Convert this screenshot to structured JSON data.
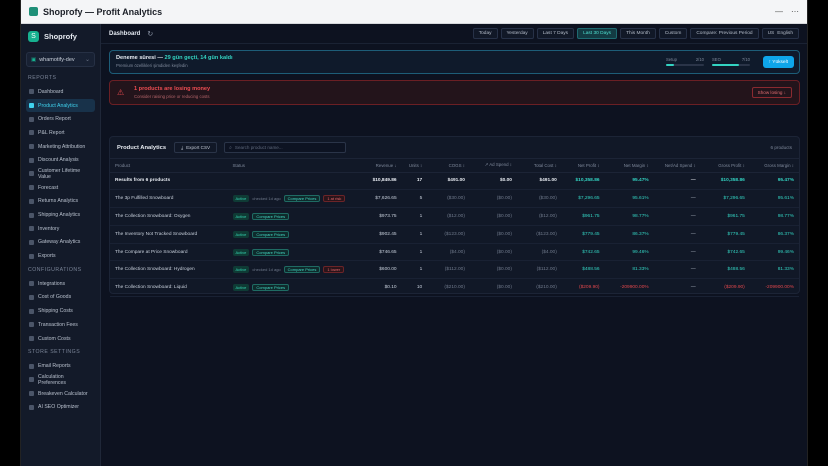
{
  "window": {
    "title": "Shoprofy — Profit Analytics"
  },
  "sidebar": {
    "brand": "Shoprofy",
    "store": "whamotify-dev",
    "sections": [
      {
        "title": "REPORTS",
        "items": [
          {
            "label": "Dashboard",
            "icon": "dashboard-icon",
            "active": false
          },
          {
            "label": "Product Analytics",
            "icon": "chart-icon",
            "active": true
          },
          {
            "label": "Orders Report",
            "icon": "orders-icon",
            "active": false
          },
          {
            "label": "P&L Report",
            "icon": "pl-icon",
            "active": false
          },
          {
            "label": "Marketing Attribution",
            "icon": "marketing-icon",
            "active": false
          },
          {
            "label": "Discount Analysis",
            "icon": "discount-icon",
            "active": false
          },
          {
            "label": "Customer Lifetime Value",
            "icon": "customer-icon",
            "active": false
          },
          {
            "label": "Forecast",
            "icon": "forecast-icon",
            "active": false
          },
          {
            "label": "Returns Analytics",
            "icon": "returns-icon",
            "active": false
          },
          {
            "label": "Shipping Analytics",
            "icon": "shipping-icon",
            "active": false
          },
          {
            "label": "Inventory",
            "icon": "inventory-icon",
            "active": false
          },
          {
            "label": "Gateway Analytics",
            "icon": "gateway-icon",
            "active": false
          },
          {
            "label": "Exports",
            "icon": "export-icon",
            "active": false
          }
        ]
      },
      {
        "title": "CONFIGURATIONS",
        "items": [
          {
            "label": "Integrations",
            "icon": "plug-icon",
            "active": false
          },
          {
            "label": "Cost of Goods",
            "icon": "cost-icon",
            "active": false
          },
          {
            "label": "Shipping Costs",
            "icon": "truck-icon",
            "active": false
          },
          {
            "label": "Transaction Fees",
            "icon": "fee-icon",
            "active": false
          },
          {
            "label": "Custom Costs",
            "icon": "plus-icon",
            "active": false
          }
        ]
      },
      {
        "title": "STORE SETTINGS",
        "items": [
          {
            "label": "Email Reports",
            "icon": "mail-icon",
            "active": false
          },
          {
            "label": "Calculation Preferences",
            "icon": "calc-icon",
            "active": false
          },
          {
            "label": "Breakeven Calculator",
            "icon": "breakeven-icon",
            "active": false
          },
          {
            "label": "AI SEO Optimizer",
            "icon": "sparkle-icon",
            "active": false
          }
        ]
      }
    ]
  },
  "topbar": {
    "title": "Dashboard",
    "ranges": [
      "Today",
      "Yesterday",
      "Last 7 Days",
      "Last 30 Days",
      "This Month",
      "Custom",
      "Compare: Previous Period"
    ],
    "active_range": "Last 30 Days",
    "language": "English",
    "language_flag": "US"
  },
  "trial": {
    "title": "Deneme süresi —",
    "highlight": "29 gün geçti, 14 gün kaldı",
    "subtitle": "Premium özellikleri şimdiden keşfedin",
    "progress": [
      {
        "label": "Setup",
        "value": "2/10",
        "fraction": 0.2
      },
      {
        "label": "SEO",
        "value": "7/10",
        "fraction": 0.7
      }
    ],
    "button": "↑ Yükselt"
  },
  "alert": {
    "title": "1 products are losing money",
    "subtitle": "Consider raising price or reducing costs",
    "button": "Show losing ↓"
  },
  "products": {
    "title": "Product Analytics",
    "export_label": "Export CSV",
    "search_placeholder": "Search product name...",
    "count": "6 products",
    "columns": [
      "Product",
      "Status",
      "Revenue ↓",
      "Units ↕",
      "COGS ↕",
      "↗ Ad Spend ↕",
      "Total Cost ↕",
      "Net Profit ↕",
      "Net Margin ↕",
      "Net/Ad Spend ↕",
      "Gross Profit ↕",
      "Gross Margin ↕"
    ],
    "summary": {
      "label": "Results from 6 products",
      "revenue": "$10,849.86",
      "units": "17",
      "cogs": "$491.00",
      "ad_spend": "$0.00",
      "total_cost": "$491.00",
      "net_profit": "$10,358.86",
      "net_margin": "95.47%",
      "net_ad": "—",
      "gross_profit": "$10,358.86",
      "gross_margin": "95.47%"
    },
    "rows": [
      {
        "name": "The 3p Fulfilled Snowboard",
        "active": "Active",
        "checked": "checked 1d ago",
        "compare": "Compare Prices",
        "warn": "1 at risk",
        "revenue": "$7,626.65",
        "units": "5",
        "cogs": "($30.00)",
        "ad_spend": "($0.00)",
        "total_cost": "($30.00)",
        "net_profit": "$7,296.65",
        "net_margin": "95.61%",
        "net_ad": "—",
        "gross_profit": "$7,296.65",
        "gross_margin": "95.61%",
        "loss": false
      },
      {
        "name": "The Collection Snowboard: Oxygen",
        "active": "Active",
        "checked": "",
        "compare": "Compare Prices",
        "warn": "",
        "revenue": "$973.75",
        "units": "1",
        "cogs": "($12.00)",
        "ad_spend": "($0.00)",
        "total_cost": "($12.00)",
        "net_profit": "$961.75",
        "net_margin": "98.77%",
        "net_ad": "—",
        "gross_profit": "$961.75",
        "gross_margin": "98.77%",
        "loss": false
      },
      {
        "name": "The Inventory Not Tracked Snowboard",
        "active": "Active",
        "checked": "",
        "compare": "Compare Prices",
        "warn": "",
        "revenue": "$902.45",
        "units": "1",
        "cogs": "($123.00)",
        "ad_spend": "($0.00)",
        "total_cost": "($123.00)",
        "net_profit": "$779.45",
        "net_margin": "86.37%",
        "net_ad": "—",
        "gross_profit": "$779.45",
        "gross_margin": "86.37%",
        "loss": false
      },
      {
        "name": "The Compare at Price Snowboard",
        "active": "Active",
        "checked": "",
        "compare": "Compare Prices",
        "warn": "",
        "revenue": "$746.65",
        "units": "1",
        "cogs": "($4.00)",
        "ad_spend": "($0.00)",
        "total_cost": "($4.00)",
        "net_profit": "$742.65",
        "net_margin": "99.46%",
        "net_ad": "—",
        "gross_profit": "$742.65",
        "gross_margin": "99.46%",
        "loss": false
      },
      {
        "name": "The Collection Snowboard: Hydrogen",
        "active": "Active",
        "checked": "checked 1d ago",
        "compare": "Compare Prices",
        "warn": "1 lower",
        "revenue": "$600.00",
        "units": "1",
        "cogs": "($112.00)",
        "ad_spend": "($0.00)",
        "total_cost": "($112.00)",
        "net_profit": "$488.56",
        "net_margin": "81.33%",
        "net_ad": "—",
        "gross_profit": "$488.56",
        "gross_margin": "81.33%",
        "loss": false
      },
      {
        "name": "The Collection Snowboard: Liquid",
        "active": "Active",
        "checked": "",
        "compare": "Compare Prices",
        "warn": "",
        "revenue": "$0.10",
        "units": "10",
        "cogs": "($210.00)",
        "ad_spend": "($0.00)",
        "total_cost": "($210.00)",
        "net_profit": "($209.90)",
        "net_margin": "-209900.00%",
        "net_ad": "—",
        "gross_profit": "($209.90)",
        "gross_margin": "-209900.00%",
        "loss": true
      }
    ]
  }
}
